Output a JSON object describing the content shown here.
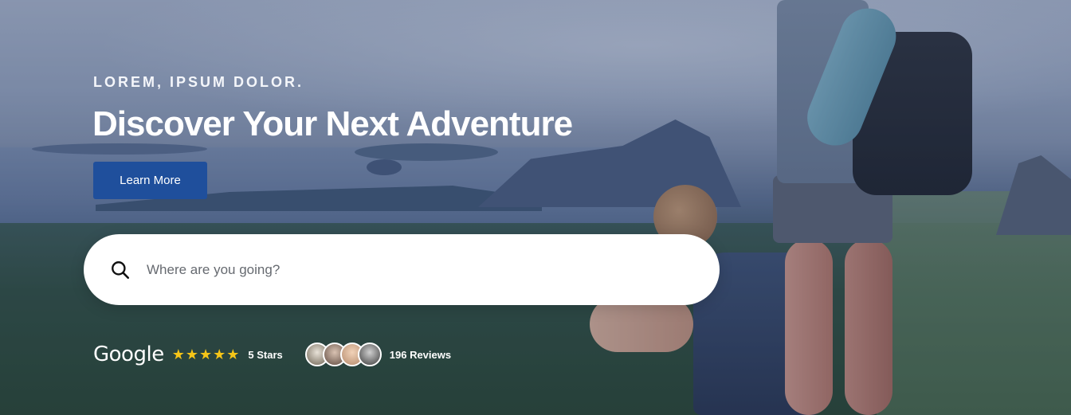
{
  "hero": {
    "eyebrow": "LOREM, IPSUM DOLOR.",
    "headline": "Discover Your Next Adventure",
    "cta_label": "Learn More",
    "overlay_tint": "#283a64"
  },
  "search": {
    "placeholder": "Where are you going?",
    "value": "",
    "icon": "search-icon"
  },
  "rating": {
    "provider": "Google",
    "stars": 5,
    "stars_label": "5 Stars",
    "star_color": "#f5c518",
    "reviews_label": "196 Reviews",
    "reviewer_avatars": 4
  },
  "colors": {
    "button": "#1f4f9c",
    "text": "#ffffff"
  }
}
